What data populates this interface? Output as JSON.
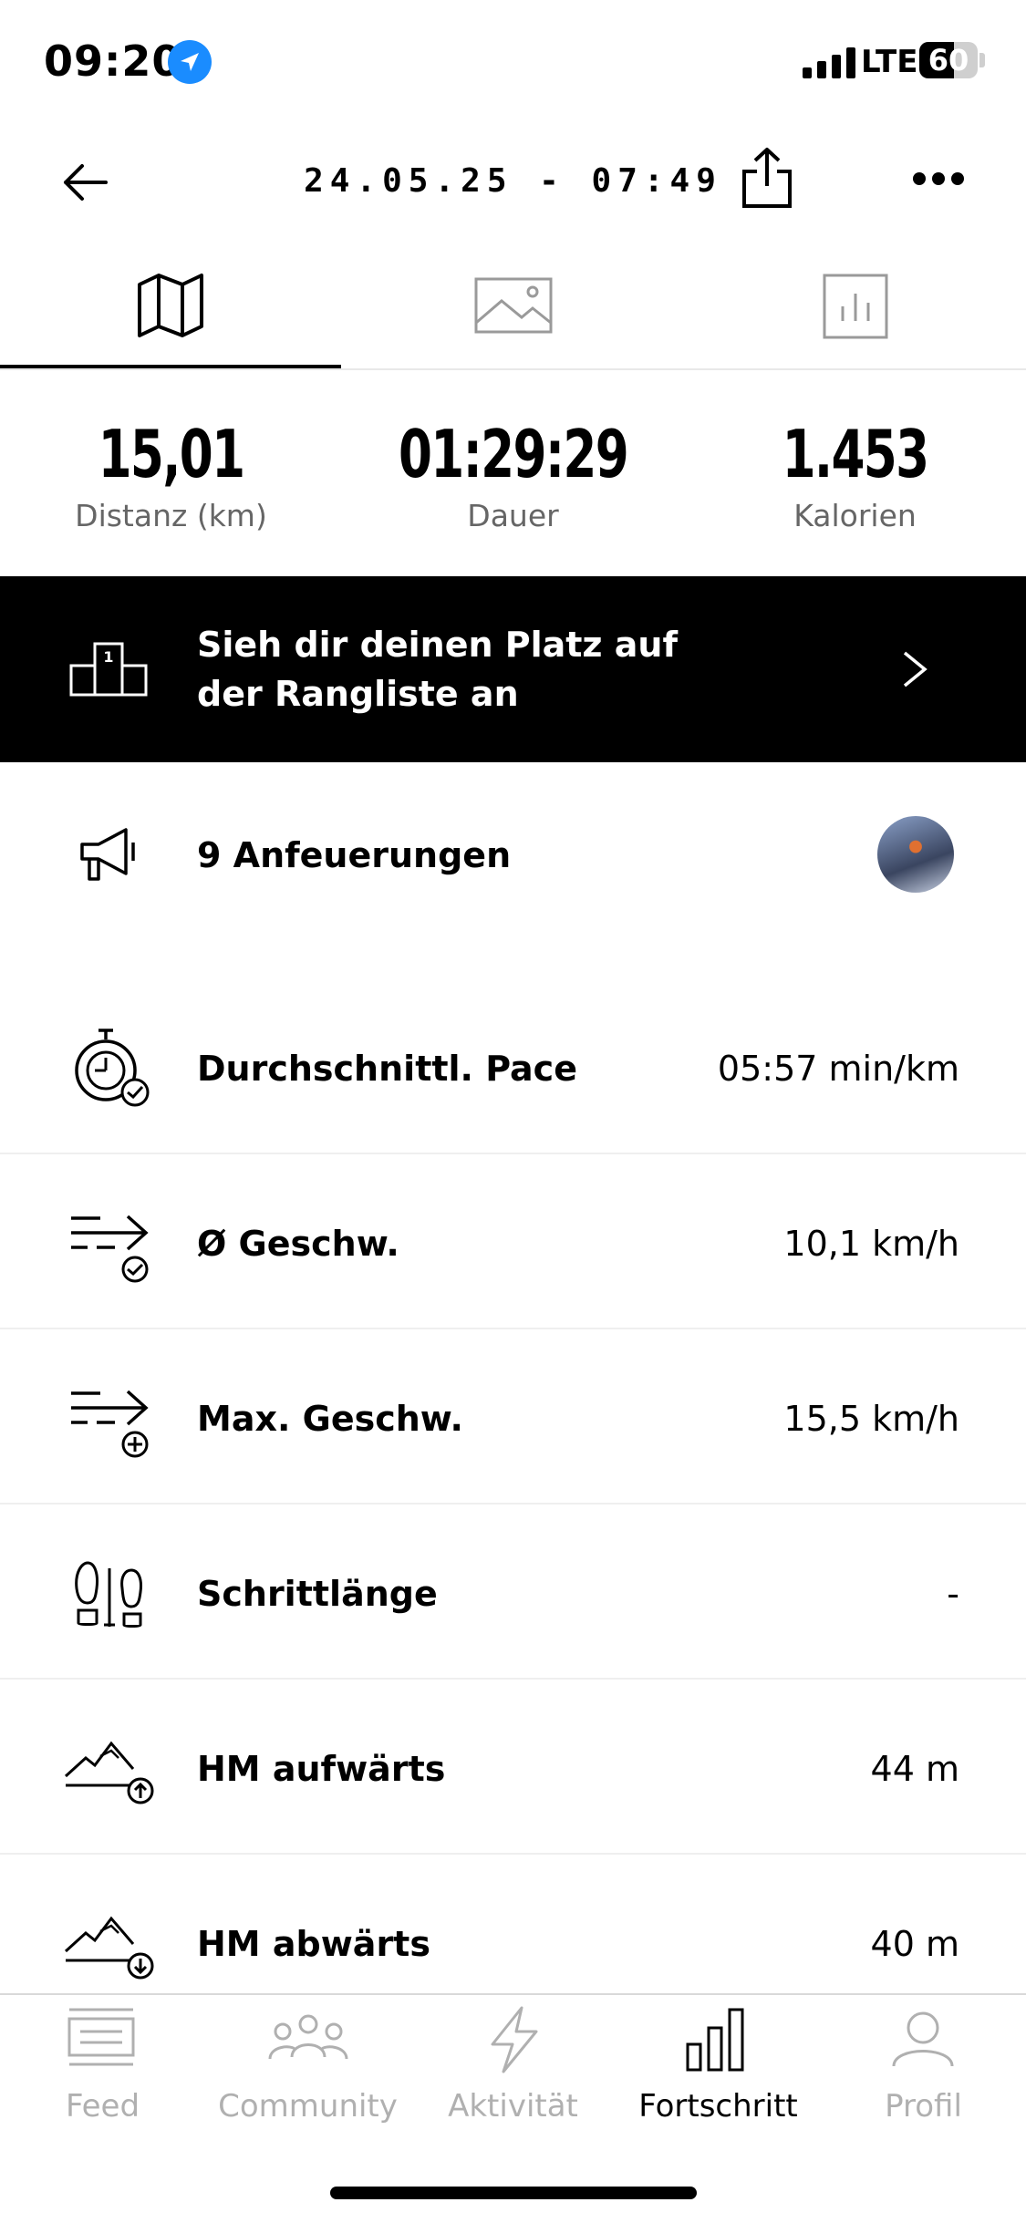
{
  "status_bar": {
    "time": "09:20",
    "network": "LTE",
    "battery": "60"
  },
  "header": {
    "title": "24.05.25 - 07:49"
  },
  "tabs": [
    {
      "icon": "map-icon",
      "active": true
    },
    {
      "icon": "image-icon",
      "active": false
    },
    {
      "icon": "bar-chart-icon",
      "active": false
    }
  ],
  "stats": [
    {
      "value": "15,01",
      "label": "Distanz (km)"
    },
    {
      "value": "01:29:29",
      "label": "Dauer"
    },
    {
      "value": "1.453",
      "label": "Kalorien"
    }
  ],
  "leaderboard": {
    "text": "Sieh dir deinen Platz auf der Rangliste an"
  },
  "cheers": {
    "label": "9 Anfeuerungen"
  },
  "metrics": [
    {
      "label": "Durchschnittl. Pace",
      "value": "05:57 min/km"
    },
    {
      "label": "Ø Geschw.",
      "value": "10,1 km/h"
    },
    {
      "label": "Max. Geschw.",
      "value": "15,5 km/h"
    },
    {
      "label": "Schrittlänge",
      "value": "-"
    },
    {
      "label": "HM aufwärts",
      "value": "44 m"
    },
    {
      "label": "HM abwärts",
      "value": "40 m"
    }
  ],
  "nav": [
    {
      "label": "Feed",
      "active": false
    },
    {
      "label": "Community",
      "active": false
    },
    {
      "label": "Aktivität",
      "active": false
    },
    {
      "label": "Fortschritt",
      "active": true
    },
    {
      "label": "Profil",
      "active": false
    }
  ]
}
